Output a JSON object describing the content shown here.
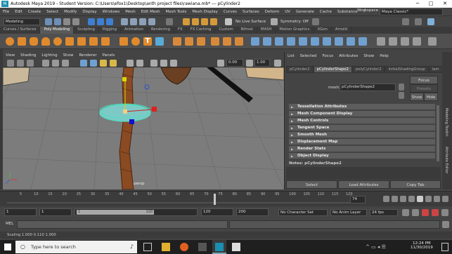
{
  "window": {
    "title": "Autodesk Maya 2019 - Student Version: C:\\Users\\efox1\\Desktop\\anth project files\\rawiana.mb*   ---   pCylinder2",
    "minimize": "─",
    "maximize": "□",
    "close": "✕"
  },
  "menubar": [
    "File",
    "Edit",
    "Create",
    "Select",
    "Modify",
    "Display",
    "Windows",
    "Mesh",
    "Edit Mesh",
    "Mesh Tools",
    "Mesh Display",
    "Curves",
    "Surfaces",
    "Deform",
    "UV",
    "Generate",
    "Cache",
    "Substance",
    "?"
  ],
  "statusline": {
    "mode": "Modeling",
    "no_live_surface": "No Live Surface",
    "symmetry": "Symmetry: Off",
    "workspace_label": "Workspace :",
    "workspace_value": "Maya Classic*"
  },
  "shelf_tabs": [
    {
      "label": "Curves / Surfaces",
      "active": false
    },
    {
      "label": "Poly Modeling",
      "active": true
    },
    {
      "label": "Sculpting",
      "active": false
    },
    {
      "label": "Rigging",
      "active": false
    },
    {
      "label": "Animation",
      "active": false
    },
    {
      "label": "Rendering",
      "active": false
    },
    {
      "label": "FX",
      "active": false
    },
    {
      "label": "FX Caching",
      "active": false
    },
    {
      "label": "Custom",
      "active": false
    },
    {
      "label": "Bifrost",
      "active": false
    },
    {
      "label": "MASH",
      "active": false
    },
    {
      "label": "Motion Graphics",
      "active": false
    },
    {
      "label": "XGen",
      "active": false
    },
    {
      "label": "Arnold",
      "active": false
    }
  ],
  "viewport": {
    "menu": [
      "View",
      "Shading",
      "Lighting",
      "Show",
      "Renderer",
      "Panels"
    ],
    "field_a": "0.00",
    "field_b": "1.00",
    "camera_label": "persp",
    "axis_y": "y",
    "axis_x": "x",
    "axis_z": "z"
  },
  "attribute_editor": {
    "menu": [
      "List",
      "Selected",
      "Focus",
      "Attributes",
      "Show",
      "Help"
    ],
    "node_tabs": [
      {
        "label": "pCylinder2",
        "active": false
      },
      {
        "label": "pCylinderShape2",
        "active": true
      },
      {
        "label": "polyCylinder2",
        "active": false
      },
      {
        "label": "initialShadingGroup",
        "active": false
      },
      {
        "label": "lam",
        "active": false
      }
    ],
    "mesh_label": "mesh:",
    "mesh_value": "pCylinderShape2",
    "focus_button": "Focus",
    "presets_button": "Presets",
    "show_button": "Show",
    "hide_button": "Hide",
    "sections": [
      "Tessellation Attributes",
      "Mesh Component Display",
      "Mesh Controls",
      "Tangent Space",
      "Smooth Mesh",
      "Displacement Map",
      "Render Stats",
      "Object Display"
    ],
    "notes": "Notes:  pCylinderShape2",
    "select_button": "Select",
    "load_attributes_button": "Load Attributes",
    "copy_tab_button": "Copy Tab"
  },
  "right_strip": [
    "Modeling Toolkit",
    "Attribute Editor"
  ],
  "timeline": {
    "ticks": [
      "5",
      "10",
      "15",
      "20",
      "25",
      "30",
      "35",
      "40",
      "45",
      "50",
      "55",
      "60",
      "65",
      "70",
      "75",
      "80",
      "85",
      "90",
      "95",
      "100",
      "105",
      "110",
      "115",
      "120"
    ],
    "current_frame": "74"
  },
  "range": {
    "start": "1",
    "start2": "1",
    "slider_start": "1",
    "slider_end": "120",
    "end": "120",
    "end2": "200",
    "character_set": "No Character Set",
    "anim_layer": "No Anim Layer",
    "fps": "24 fps"
  },
  "command_line": {
    "label": "MEL"
  },
  "help_line": "Scaling     1.000     0.110     1.000",
  "taskbar": {
    "search_placeholder": "Type here to search",
    "time": "12:24 PM",
    "date": "11/30/2019"
  },
  "colors": {
    "accent_tab": "#5a5a5a",
    "selection_green": "#4be0c0",
    "mesh_trunk": "#8a4a22"
  }
}
